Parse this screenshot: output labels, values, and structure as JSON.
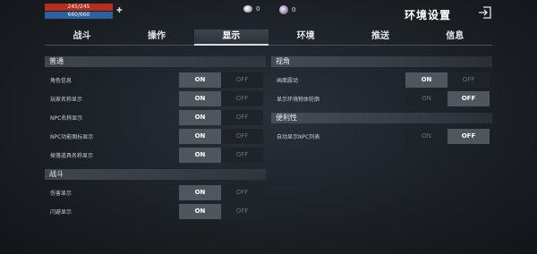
{
  "status": {
    "hp_text": "245/245",
    "mp_text": "660/660"
  },
  "currency": {
    "coins": "0",
    "gems": "0"
  },
  "header": {
    "title": "环境设置"
  },
  "tabs": [
    {
      "label": "战斗",
      "active": false
    },
    {
      "label": "操作",
      "active": false
    },
    {
      "label": "显示",
      "active": true
    },
    {
      "label": "环境",
      "active": false
    },
    {
      "label": "推送",
      "active": false
    },
    {
      "label": "信息",
      "active": false
    }
  ],
  "toggle_labels": {
    "on": "ON",
    "off": "OFF"
  },
  "left": {
    "general": {
      "title": "普通",
      "rows": [
        {
          "label": "角色信息",
          "value": "on"
        },
        {
          "label": "玩家名称显示",
          "value": "on"
        },
        {
          "label": "NPC名称显示",
          "value": "on"
        },
        {
          "label": "NPC功能图标显示",
          "value": "on"
        },
        {
          "label": "掉落道具名称显示",
          "value": "on"
        }
      ]
    },
    "combat": {
      "title": "战斗",
      "rows": [
        {
          "label": "伤害显示",
          "value": "on"
        },
        {
          "label": "闪避显示",
          "value": "on"
        }
      ]
    }
  },
  "right": {
    "view": {
      "title": "视角",
      "rows": [
        {
          "label": "画面震动",
          "value": "on"
        },
        {
          "label": "显示环境物体轮廓",
          "value": "off"
        }
      ]
    },
    "convenience": {
      "title": "便利性",
      "rows": [
        {
          "label": "自动显示NPC列表",
          "value": "off"
        }
      ]
    }
  }
}
